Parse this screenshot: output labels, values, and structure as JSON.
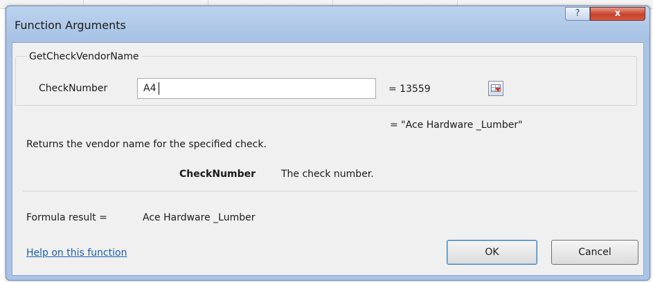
{
  "window": {
    "title": "Function Arguments",
    "help_label": "?",
    "close_label": "x"
  },
  "function": {
    "name": "GetCheckVendorName",
    "argument_label": "CheckNumber",
    "argument_value": "A4",
    "argument_result": "= 13559",
    "function_result": "= \"Ace Hardware _Lumber\"",
    "description": "Returns the vendor name for the specified check.",
    "argument_help_name": "CheckNumber",
    "argument_help_text": "The check number."
  },
  "formula": {
    "result_label": "Formula result =",
    "result_value": "Ace Hardware _Lumber"
  },
  "footer": {
    "help_link": "Help on this function",
    "ok_label": "OK",
    "cancel_label": "Cancel"
  },
  "colors": {
    "title_bar": "#a9c4e6",
    "close_button": "#c7412b",
    "link": "#1a5ea8",
    "ok_focus_border": "#3c7fb1"
  },
  "icons": {
    "collapse_dialog": "range-select-icon"
  }
}
